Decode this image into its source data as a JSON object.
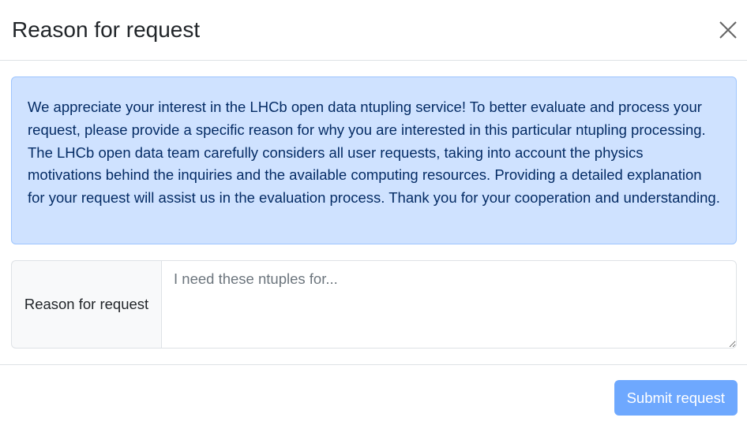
{
  "header": {
    "title": "Reason for request",
    "close_icon": "close-icon"
  },
  "body": {
    "info_text": "We appreciate your interest in the LHCb open data ntupling service! To better evaluate and process your request, please provide a specific reason for why you are interested in this particular ntupling processing. The LHCb open data team carefully considers all user requests, taking into account the physics motivations behind the inquiries and the available computing resources. Providing a detailed explanation for your request will assist us in the evaluation process. Thank you for your cooperation and understanding.",
    "reason_label": "Reason for request",
    "reason_value": "",
    "reason_placeholder": "I need these ntuples for..."
  },
  "footer": {
    "submit_label": "Submit request",
    "submit_disabled": true
  },
  "colors": {
    "alert_bg": "#cfe2ff",
    "alert_border": "#9ec5fe",
    "alert_text": "#052c65",
    "primary_disabled": "#6ea8fe"
  }
}
